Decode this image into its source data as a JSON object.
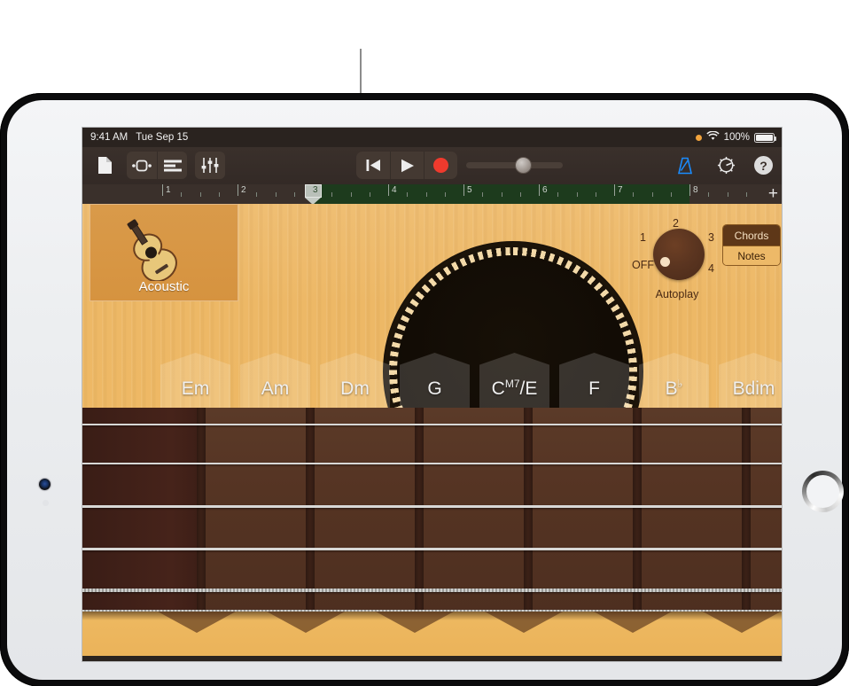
{
  "device": {
    "name": "iPad",
    "home_button": "home-button",
    "camera": "front-camera",
    "sensor": "ambient-light-sensor"
  },
  "status_bar": {
    "time": "9:41 AM",
    "date": "Tue Sep 15",
    "recording_indicator": "orange-dot",
    "wifi": "wifi-icon",
    "battery_percent": "100%",
    "battery_icon": "battery-full-icon"
  },
  "toolbar": {
    "left": [
      {
        "name": "my-songs-button",
        "icon": "document-icon",
        "label": "My Songs"
      },
      {
        "name": "loop-browser-button",
        "icon": "loop-browser-icon",
        "label": "Loop Browser"
      },
      {
        "name": "tracks-view-button",
        "icon": "tracks-view-icon",
        "label": "Tracks View"
      },
      {
        "name": "mixer-button",
        "icon": "sliders-icon",
        "label": "Mixer"
      }
    ],
    "transport": [
      {
        "name": "rewind-button",
        "icon": "rewind-icon",
        "label": "Go to Beginning"
      },
      {
        "name": "play-button",
        "icon": "play-icon",
        "label": "Play"
      },
      {
        "name": "record-button",
        "icon": "record-icon",
        "label": "Record"
      }
    ],
    "master_volume": {
      "name": "master-volume-slider",
      "value": 50
    },
    "right": [
      {
        "name": "metronome-button",
        "icon": "metronome-icon",
        "label": "Metronome",
        "active": true
      },
      {
        "name": "settings-button",
        "icon": "gear-icon",
        "label": "Settings"
      },
      {
        "name": "help-button",
        "icon": "question-mark-icon",
        "label": "Help"
      }
    ],
    "accent_blue": "#1a8cff",
    "record_red": "#ef3a2d"
  },
  "ruler": {
    "bars": [
      "1",
      "2",
      "3",
      "4",
      "5",
      "6",
      "7",
      "8"
    ],
    "playhead_bar": "3",
    "cycle_region_start_bar": "3",
    "cycle_region_end_bar": "8",
    "add_button": "+",
    "green": "#1d3b1d"
  },
  "instrument": {
    "card_name": "instrument-card",
    "label": "Acoustic",
    "icon": "acoustic-guitar-icon"
  },
  "autoplay": {
    "caption": "Autoplay",
    "positions": [
      "OFF",
      "1",
      "2",
      "3",
      "4"
    ],
    "selected": "OFF"
  },
  "mode_switch": {
    "options": [
      "Chords",
      "Notes"
    ],
    "selected": "Chords"
  },
  "chords": [
    {
      "root": "Em",
      "sup": "",
      "tail": ""
    },
    {
      "root": "Am",
      "sup": "",
      "tail": ""
    },
    {
      "root": "Dm",
      "sup": "",
      "tail": ""
    },
    {
      "root": "G",
      "sup": "",
      "tail": ""
    },
    {
      "root": "C",
      "sup": "M7",
      "tail": "/E"
    },
    {
      "root": "F",
      "sup": "",
      "tail": ""
    },
    {
      "root": "B",
      "sup": "♭",
      "tail": ""
    },
    {
      "root": "Bdim",
      "sup": "",
      "tail": ""
    }
  ],
  "fretboard": {
    "string_count": 6,
    "name": "guitar-strings"
  },
  "callout": {
    "name": "callout-line"
  }
}
